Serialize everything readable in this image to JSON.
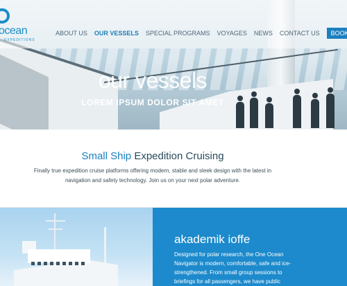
{
  "brand": {
    "name": "ocean",
    "tagline": "EXPEDITIONS"
  },
  "nav": {
    "items": [
      {
        "label": "ABOUT US"
      },
      {
        "label": "OUR VESSELS"
      },
      {
        "label": "SPECIAL PROGRAMS"
      },
      {
        "label": "VOYAGES"
      },
      {
        "label": "NEWS"
      },
      {
        "label": "CONTACT US"
      }
    ],
    "cta": "BOOK NOW"
  },
  "hero": {
    "title": "our vessels",
    "subtitle": "LOREM IPSUM DOLOR SIT AMET"
  },
  "intro": {
    "heading_light": "Small Ship ",
    "heading_dark": "Expedition Cruising",
    "body": "Finally true expedition cruise platforms offering modern, stable and sleek design with the latest in navigation and safety technology. Join us on your next polar adventure."
  },
  "feature": {
    "title": "akademik ioffe",
    "body": "Designed for polar research, the One Ocean Navigator is modern, comfortable, safe and ice-strengthened. From small group sessions to briefings for all passengers, we have public"
  },
  "colors": {
    "accent": "#1b7fc0",
    "panel": "#1c8acc"
  }
}
